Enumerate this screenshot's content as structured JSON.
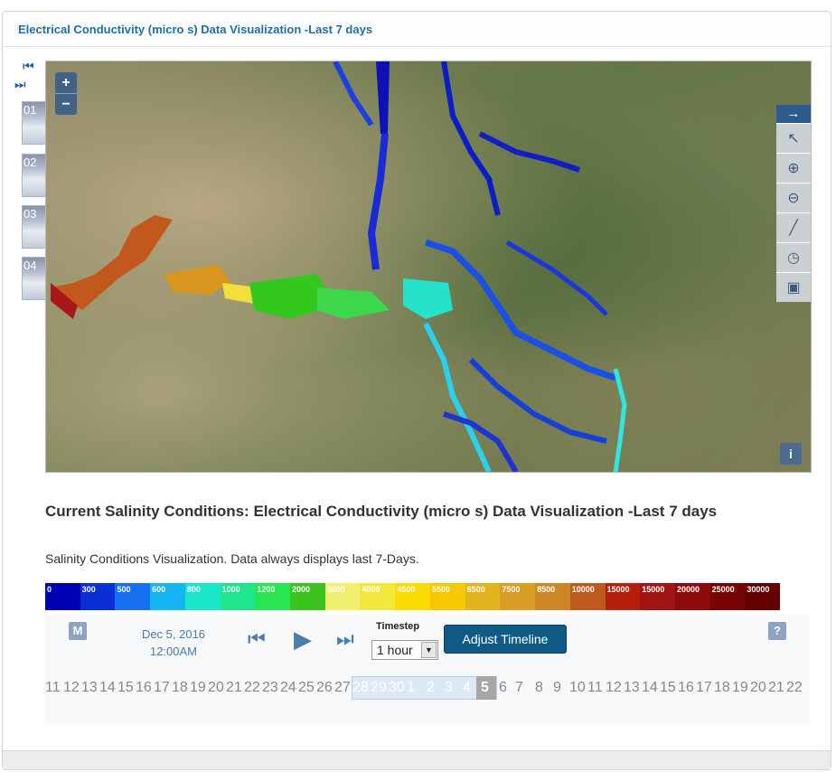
{
  "panel": {
    "title": "Electrical Conductivity (micro s) Data Visualization -Last 7 days"
  },
  "side_nav": {
    "first_icon": "first-frame-icon",
    "last_icon": "last-frame-icon",
    "thumbnails": [
      "01",
      "02",
      "03",
      "04"
    ]
  },
  "map": {
    "zoom_in": "+",
    "zoom_out": "−",
    "tool_head_icon": "arrow-right-icon",
    "tools": [
      "pointer-icon",
      "zoom-in-icon",
      "zoom-out-icon",
      "measure-icon",
      "clock-icon",
      "fullscreen-icon"
    ],
    "info": "i"
  },
  "section": {
    "title": "Current Salinity Conditions: Electrical Conductivity (micro s) Data Visualization -Last 7 days",
    "description": "Salinity Conditions Visualization. Data always displays last 7-Days."
  },
  "legend": [
    {
      "label": "0",
      "color": "#0000b4"
    },
    {
      "label": "300",
      "color": "#0a2fd6"
    },
    {
      "label": "500",
      "color": "#1470f0"
    },
    {
      "label": "600",
      "color": "#14b4f0"
    },
    {
      "label": "800",
      "color": "#18e6c8"
    },
    {
      "label": "1000",
      "color": "#1ee68c"
    },
    {
      "label": "1200",
      "color": "#28e650"
    },
    {
      "label": "2000",
      "color": "#3cc41e"
    },
    {
      "label": "3600",
      "color": "#f0f06e"
    },
    {
      "label": "4000",
      "color": "#f5e83c"
    },
    {
      "label": "4500",
      "color": "#fadc00"
    },
    {
      "label": "5500",
      "color": "#f5c800"
    },
    {
      "label": "6500",
      "color": "#e1b41e"
    },
    {
      "label": "7500",
      "color": "#d79e23"
    },
    {
      "label": "8500",
      "color": "#cd8728"
    },
    {
      "label": "10000",
      "color": "#be5a1e"
    },
    {
      "label": "15000",
      "color": "#b41e0a"
    },
    {
      "label": "15000",
      "color": "#a01414"
    },
    {
      "label": "20000",
      "color": "#8c0a0a"
    },
    {
      "label": "25000",
      "color": "#780505"
    },
    {
      "label": "30000",
      "color": "#640000"
    }
  ],
  "controls": {
    "m_label": "M",
    "help_label": "?",
    "date": "Dec 5, 2016",
    "time": "12:00AM",
    "prev_icon": "step-back-icon",
    "play_icon": "play-icon",
    "next_icon": "step-forward-icon",
    "timestep_label": "Timestep",
    "timestep_value": "1 hour",
    "adjust_label": "Adjust Timeline"
  },
  "timeline": {
    "days": [
      "11",
      "12",
      "13",
      "14",
      "15",
      "16",
      "17",
      "18",
      "19",
      "20",
      "21",
      "22",
      "23",
      "24",
      "25",
      "26",
      "27",
      "28",
      "29",
      "30",
      "1",
      "2",
      "3",
      "4",
      "5",
      "6",
      "7",
      "8",
      "9",
      "10",
      "11",
      "12",
      "13",
      "14",
      "15",
      "16",
      "17",
      "18",
      "19",
      "20",
      "21",
      "22"
    ],
    "window_days": [
      "28",
      "29",
      "30",
      "1",
      "2",
      "3",
      "4"
    ],
    "current_day": "5"
  }
}
